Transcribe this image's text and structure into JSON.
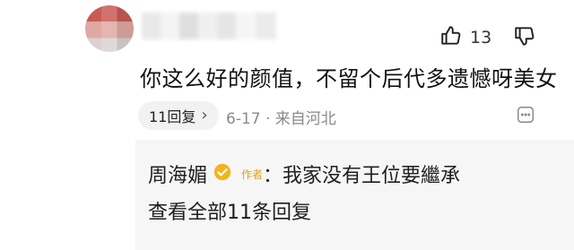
{
  "comment": {
    "text": "你这么好的颜值，不留个后代多遗憾呀美女",
    "like_count": "13",
    "reply_count_label": "11回复",
    "meta": "6-17 · 来自河北"
  },
  "reply": {
    "author": "周海媚",
    "author_tag": "作者",
    "separator": "：",
    "content": "我家没有王位要繼承",
    "view_all": "查看全部11条回复"
  },
  "colors": {
    "verify_gold": "#f4b31c",
    "author_tag": "#e1a21f"
  },
  "icons": [
    "thumbs-up-icon",
    "thumbs-down-icon",
    "chevron-right-icon",
    "more-options-icon",
    "verified-badge-icon"
  ]
}
